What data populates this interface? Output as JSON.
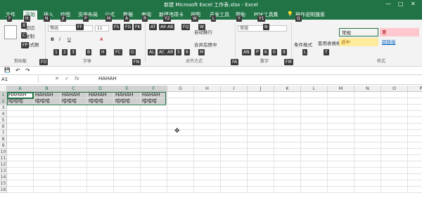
{
  "window": {
    "title": "新建 Microsoft Excel 工作表.xlsx - Excel",
    "min": "—",
    "max": "□",
    "close": "✕"
  },
  "tabs": [
    {
      "label": "文件"
    },
    {
      "label": "开始"
    },
    {
      "label": "插入"
    },
    {
      "label": "绘图"
    },
    {
      "label": "页面布局"
    },
    {
      "label": "公式"
    },
    {
      "label": "数据"
    },
    {
      "label": "审阅"
    },
    {
      "label": "新建选项卡"
    },
    {
      "label": "视图"
    },
    {
      "label": "开发工具"
    },
    {
      "label": "帮助"
    },
    {
      "label": "PDF工具集"
    },
    {
      "label": "操作说明搜索"
    }
  ],
  "keytips_tabs": [
    "F",
    "H",
    "N",
    "JI",
    "P",
    "M",
    "A",
    "R",
    "Y2",
    "W",
    "L",
    "Y",
    "Y1",
    "Q"
  ],
  "ribbon": {
    "clipboard": {
      "cut": "剪切",
      "copy": "复制",
      "paste_format": "格式刷",
      "group": "剪贴板"
    },
    "font": {
      "name": "等线",
      "size": "11",
      "group": "字体",
      "bold": "B",
      "italic": "I",
      "underline": "U",
      "color": "A"
    },
    "alignment": {
      "wrap": "自动换行",
      "merge": "合并后居中",
      "group": "对齐方式"
    },
    "number": {
      "format": "常规",
      "group": "数字"
    },
    "styles": {
      "cond": "条件格式",
      "table": "套用表格格式",
      "group": "样式",
      "cells": [
        {
          "label": "常规",
          "bg": "#ffffff",
          "fg": "#333333"
        },
        {
          "label": "差",
          "bg": "#ffc7ce",
          "fg": "#9c0006"
        },
        {
          "label": "适中",
          "bg": "#ffeb9c",
          "fg": "#9c6500"
        },
        {
          "label": "超链接",
          "bg": "#ffffff",
          "fg": "#0563c1"
        }
      ]
    },
    "keytips": [
      "X",
      "C",
      "FP",
      "FF",
      "FS",
      "FG",
      "FK",
      "AT",
      "AM",
      "AB",
      "FQ",
      "W",
      "N",
      "1",
      "2",
      "3",
      "B",
      "H",
      "FC",
      "G",
      "FN",
      "AL",
      "AC",
      "AR",
      "5",
      "6",
      "M",
      "AN",
      "P",
      "K",
      "0",
      "9",
      "FM",
      "L",
      "T",
      "FA",
      "FO"
    ]
  },
  "qat": {
    "save": "💾",
    "undo": "↶",
    "redo": "↷"
  },
  "formula_bar": {
    "namebox": "A1",
    "cancel": "✕",
    "enter": "✓",
    "fx": "fx",
    "value": "HAHAH"
  },
  "columns": [
    "A",
    "B",
    "C",
    "D",
    "E",
    "F",
    "G",
    "H",
    "I",
    "J",
    "K",
    "L",
    "M",
    "N",
    "O",
    "P"
  ],
  "rows": [
    "1",
    "2",
    "3",
    "4",
    "5",
    "6",
    "7",
    "8",
    "9",
    "10",
    "11",
    "12",
    "13",
    "14",
    "15",
    "16"
  ],
  "data": [
    [
      "HAHAH",
      "HAHAH",
      "HAHAH",
      "HAHAH",
      "HAHAH",
      "HAHAH"
    ],
    [
      "哈哈哈",
      "哈哈哈",
      "哈哈哈",
      "哈哈哈",
      "哈哈哈",
      "哈哈哈"
    ]
  ],
  "accent": "#217346"
}
